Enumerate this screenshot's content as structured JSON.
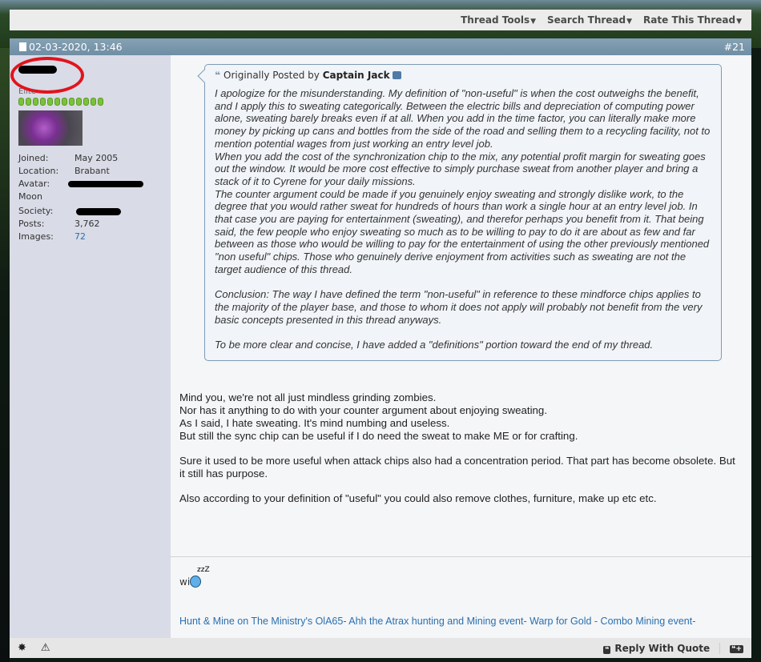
{
  "toolbar": {
    "thread_tools": "Thread Tools",
    "search_thread": "Search Thread",
    "rate_thread": "Rate This Thread"
  },
  "post": {
    "date": "02-03-2020, 13:46",
    "number": "#21",
    "author": {
      "rank": "Elite",
      "reputation_pips": 12,
      "info": [
        {
          "label": "Joined:",
          "value": "May 2005"
        },
        {
          "label": "Location:",
          "value": "Brabant"
        },
        {
          "label": "Avatar:",
          "value": ""
        },
        {
          "label": "Society:",
          "value": ""
        },
        {
          "label": "Posts:",
          "value": "3,762"
        },
        {
          "label": "Images:",
          "value": "72"
        }
      ],
      "avatar_continuation": "Moon"
    },
    "quote": {
      "prefix": "Originally Posted by",
      "author": "Captain Jack",
      "paragraphs": [
        "I apologize for the misunderstanding. My definition of \"non-useful\" is when the cost outweighs the benefit, and I apply this to sweating categorically. Between the electric bills and depreciation of computing power alone, sweating barely breaks even if at all. When you add in the time factor, you can literally make more money by picking up cans and bottles from the side of the road and selling them to a recycling facility, not to mention potential wages from just working an entry level job.",
        "When you add the cost of the synchronization chip to the mix, any potential profit margin for sweating goes out the window. It would be more cost effective to simply purchase sweat from another player and bring a stack of it to Cyrene for your daily missions.",
        "The counter argument could be made if you genuinely enjoy sweating and strongly dislike work, to the degree that you would rather sweat for hundreds of hours than work a single hour at an entry level job. In that case you are paying for entertainment (sweating), and therefor perhaps you benefit from it. That being said, the few people who enjoy sweating so much as to be willing to pay to do it are about as few and far between as those who would be willing to pay for the entertainment of using the other previously mentioned \"non useful\" chips. Those who genuinely derive enjoyment from activities such as sweating are not the target audience of this thread.",
        "Conclusion: The way I have defined the term \"non-useful\" in reference to these mindforce chips applies to the majority of the player base, and those to whom it does not apply will probably not benefit from the very basic concepts presented in this thread anyways.",
        "To be more clear and concise, I have added a \"definitions\" portion toward the end of my thread."
      ]
    },
    "body": [
      [
        "Mind you, we're not all just mindless grinding zombies.",
        "Nor has it anything to do with your counter argument about enjoying sweating.",
        "As I said, I hate sweating. It's mind numbing and useless.",
        "But still the sync chip can be useful if I do need the sweat to make ME or for crafting."
      ],
      [
        "Sure it used to be more useful when attack chips also had a concentration period. That part has become obsolete. But it still has purpose."
      ],
      [
        "Also according to your definition of \"useful\" you could also remove clothes, furniture, make up etc etc."
      ]
    ],
    "signature": {
      "line1": "wi",
      "sleep_text": "zzZ",
      "link": "Hunt & Mine on The Ministry's OlA65- Ahh the Atrax hunting and Mining event- Warp for Gold - Combo Mining event-"
    }
  },
  "footer": {
    "reply_with_quote": "Reply With Quote",
    "quote_icon": "❝",
    "multi_quote_icon": "❝+"
  },
  "colors": {
    "header": "#7f9bb0",
    "sidebar": "#d9dbe6",
    "link": "#2a6fb0",
    "annotation_ring": "#e0141e"
  }
}
